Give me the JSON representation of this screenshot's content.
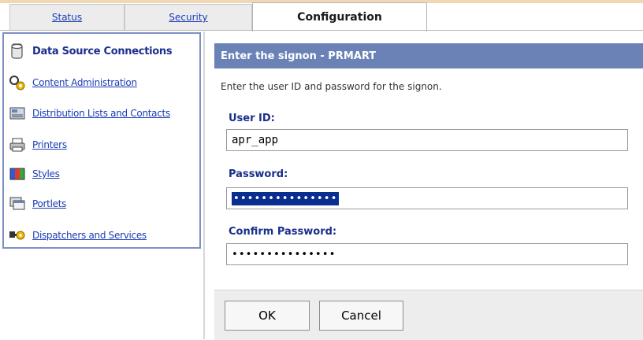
{
  "tabs": [
    {
      "label": "Status"
    },
    {
      "label": "Security"
    },
    {
      "label": "Configuration"
    }
  ],
  "active_tab": "Configuration",
  "nav": {
    "items": [
      {
        "label": "Data Source Connections",
        "icon": "database-icon",
        "selected": true
      },
      {
        "label": "Content Administration",
        "icon": "content-admin-icon"
      },
      {
        "label": "Distribution Lists and Contacts",
        "icon": "contacts-icon"
      },
      {
        "label": "Printers",
        "icon": "printer-icon"
      },
      {
        "label": "Styles",
        "icon": "styles-icon"
      },
      {
        "label": "Portlets",
        "icon": "portlets-icon"
      },
      {
        "label": "Dispatchers and Services",
        "icon": "dispatchers-icon"
      }
    ]
  },
  "dialog": {
    "title": "Enter the signon - PRMART",
    "instructions": "Enter the user ID and password for the signon.",
    "user_id_label": "User ID:",
    "user_id_value": "apr_app",
    "password_label": "Password:",
    "password_value": "•••••••••••••••",
    "confirm_label": "Confirm Password:",
    "confirm_value": "•••••••••••••••"
  },
  "buttons": {
    "ok": "OK",
    "cancel": "Cancel"
  },
  "colors": {
    "header_bg": "#6b82b6",
    "link": "#1a3cb4",
    "nav_border": "#7e8fc2",
    "selection": "#0a2e8f"
  }
}
